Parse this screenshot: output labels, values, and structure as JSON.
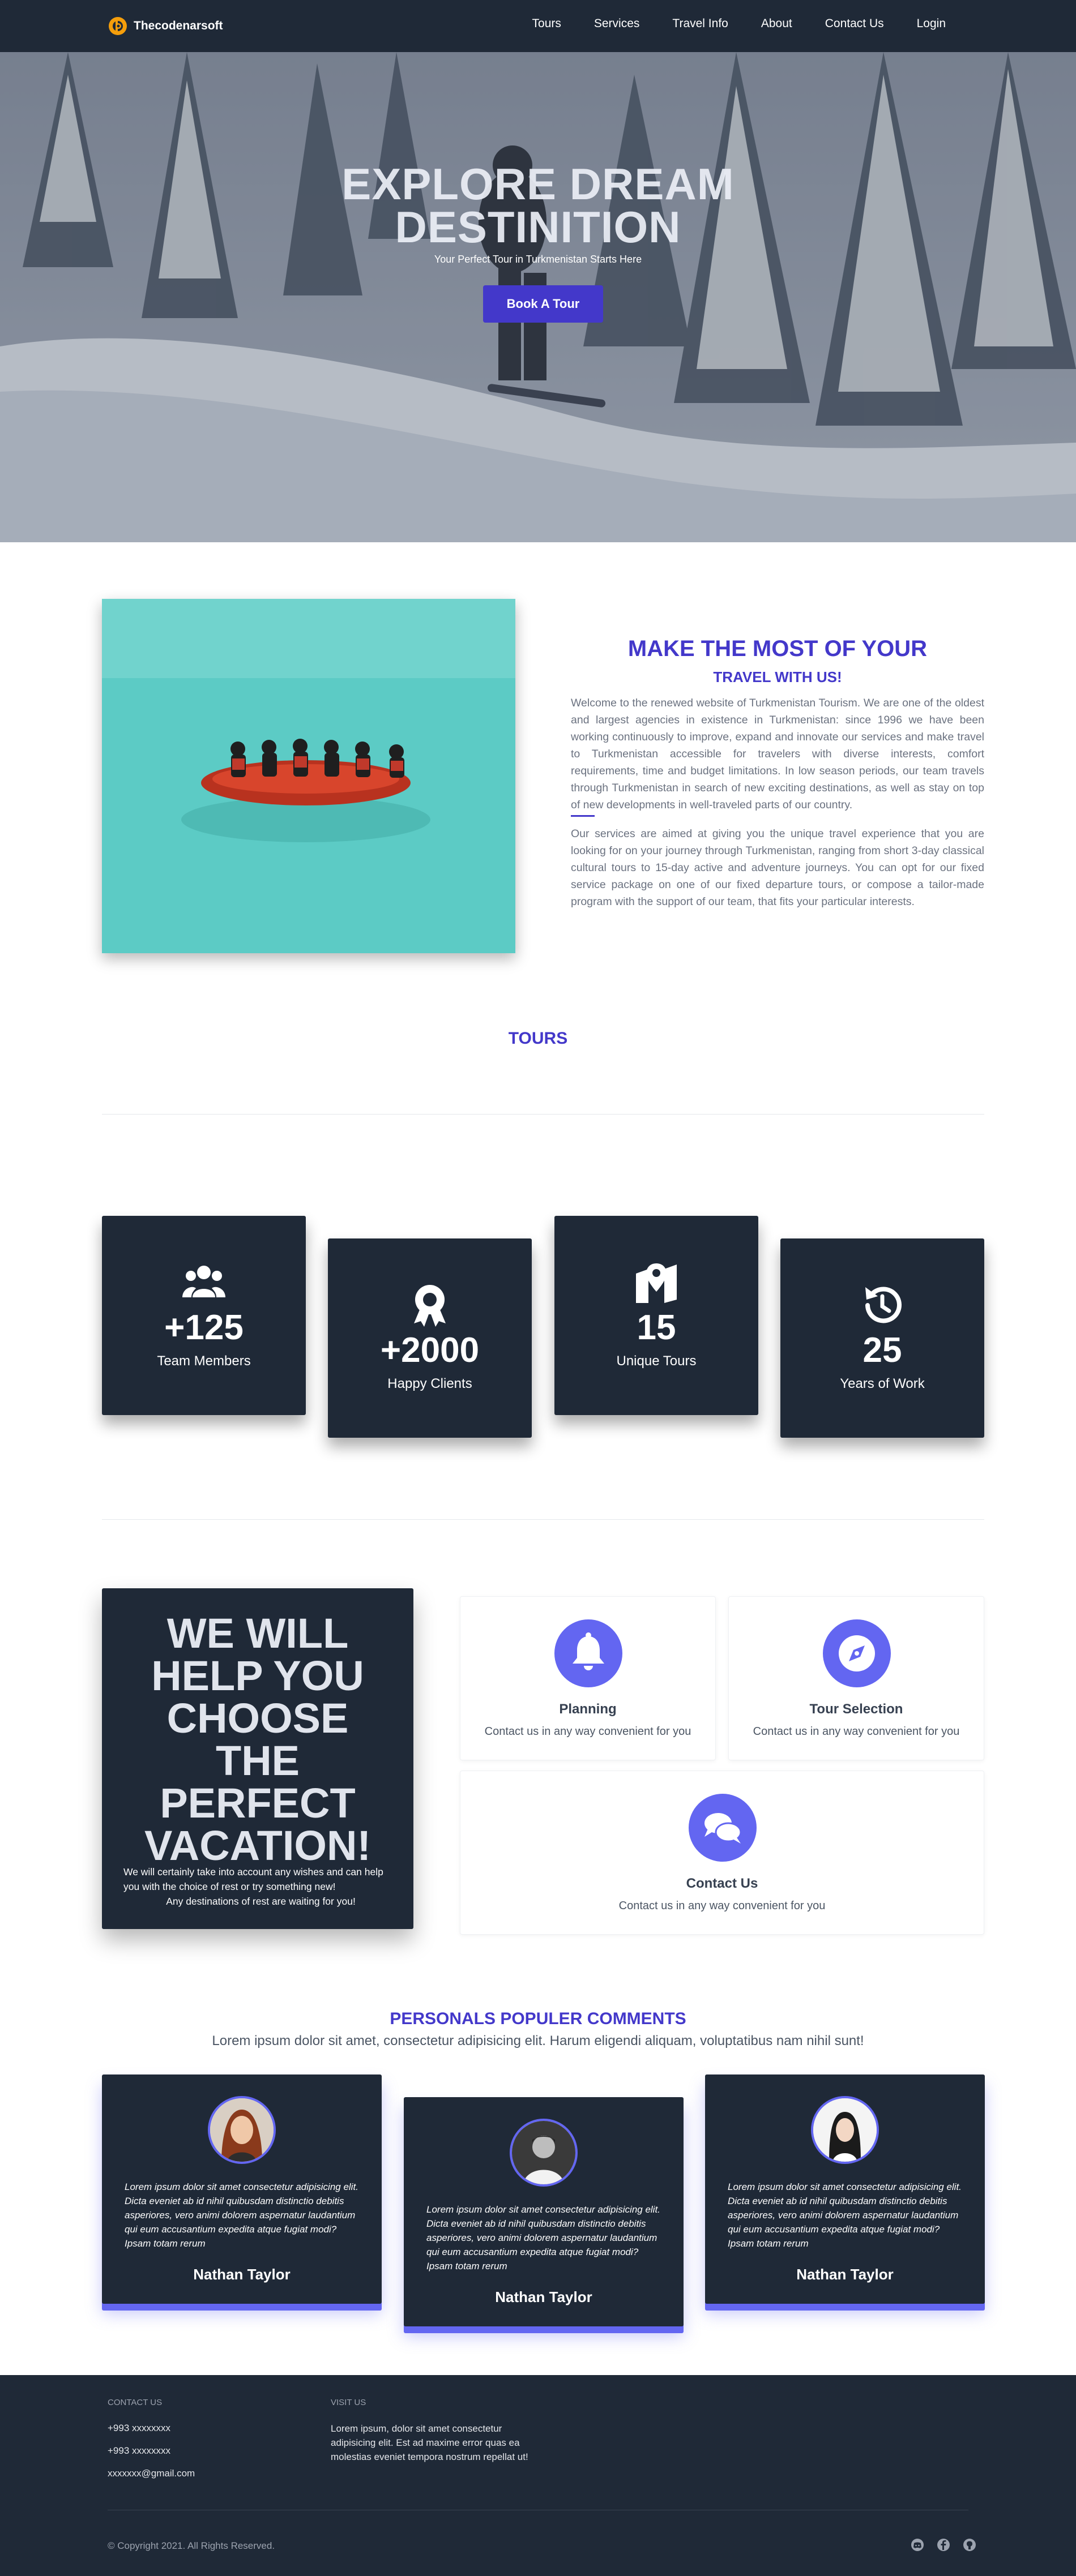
{
  "nav": {
    "brand": "Thecodenarsoft",
    "links": [
      "Tours",
      "Services",
      "Travel Info",
      "About",
      "Contact Us",
      "Login"
    ]
  },
  "hero": {
    "title_line1": "EXPLORE DREAM",
    "title_line2": "DESTINITION",
    "subtitle": "Your Perfect Tour in Turkmenistan Starts Here",
    "button": "Book A Tour"
  },
  "about": {
    "title": "MAKE THE MOST OF YOUR",
    "subtitle": "TRAVEL WITH US!",
    "paragraph1": "Welcome to the renewed website of Turkmenistan Tourism. We are one of the oldest and largest agencies in existence in Turkmenistan: since 1996 we have been working continuously to improve, expand and innovate our services and make travel to Turkmenistan accessible for travelers with diverse interests, comfort requirements, time and budget limitations. In low season periods, our team travels through Turkmenistan in search of new exciting destinations, as well as stay on top of new developments in well-traveled parts of our country.",
    "paragraph2": "Our services are aimed at giving you the unique travel experience that you are looking for on your journey through Turkmenistan, ranging from short 3-day classical cultural tours to 15-day active and adventure journeys. You can opt for our fixed service package on one of our fixed departure tours, or compose a tailor-made program with the support of our team, that fits your particular interests."
  },
  "tours": {
    "title": "TOURS"
  },
  "stats": [
    {
      "icon": "users-icon",
      "number": "+125",
      "label": "Team Members"
    },
    {
      "icon": "award-icon",
      "number": "+2000",
      "label": "Happy Clients"
    },
    {
      "icon": "map-marker-icon",
      "number": "15",
      "label": "Unique Tours"
    },
    {
      "icon": "history-icon",
      "number": "25",
      "label": "Years of Work"
    }
  ],
  "help": {
    "title_lines": [
      "WE WILL",
      "HELP YOU",
      "CHOOSE",
      "THE",
      "PERFECT",
      "VACATION!"
    ],
    "text_line1": "We will certainly take into account any wishes and can help you with the choice of rest or try something new!",
    "text_line2": "Any destinations of rest are waiting for you!"
  },
  "services": [
    {
      "icon": "bell-icon",
      "name": "Planning",
      "desc": "Contact us in any way convenient for you"
    },
    {
      "icon": "compass-icon",
      "name": "Tour Selection",
      "desc": "Contact us in any way convenient for you"
    },
    {
      "icon": "comments-icon",
      "name": "Contact Us",
      "desc": "Contact us in any way convenient for you"
    }
  ],
  "comments": {
    "title": "PERSONALS POPULER COMMENTS",
    "subtitle": "Lorem ipsum dolor sit amet, consectetur adipisicing elit. Harum eligendi aliquam, voluptatibus nam nihil sunt!",
    "items": [
      {
        "text": "Lorem ipsum dolor sit amet consectetur adipisicing elit. Dicta eveniet ab id nihil quibusdam distinctio debitis asperiores, vero animi dolorem aspernatur laudantium qui eum accusantium expedita atque fugiat modi? Ipsam totam rerum",
        "name": "Nathan Taylor"
      },
      {
        "text": "Lorem ipsum dolor sit amet consectetur adipisicing elit. Dicta eveniet ab id nihil quibusdam distinctio debitis asperiores, vero animi dolorem aspernatur laudantium qui eum accusantium expedita atque fugiat modi? Ipsam totam rerum",
        "name": "Nathan Taylor"
      },
      {
        "text": "Lorem ipsum dolor sit amet consectetur adipisicing elit. Dicta eveniet ab id nihil quibusdam distinctio debitis asperiores, vero animi dolorem aspernatur laudantium qui eum accusantium expedita atque fugiat modi? Ipsam totam rerum",
        "name": "Nathan Taylor"
      }
    ]
  },
  "footer": {
    "contact_heading": "CONTACT US",
    "phone1": "+993 xxxxxxxx",
    "phone2": "+993 xxxxxxxx",
    "email": "xxxxxxx@gmail.com",
    "visit_heading": "VISIT US",
    "visit_text": "Lorem ipsum, dolor sit amet consectetur adipisicing elit. Est ad maxime error quas ea molestias eveniet tempora nostrum repellat ut!",
    "copyright": "© Copyright 2021. All Rights Reserved.",
    "social_icons": [
      "discord-icon",
      "facebook-icon",
      "github-icon"
    ]
  },
  "colors": {
    "dark": "#1f2937",
    "accent": "#4338ca",
    "accent_light": "#6366f1",
    "brand_logo": "#f59e0b"
  }
}
